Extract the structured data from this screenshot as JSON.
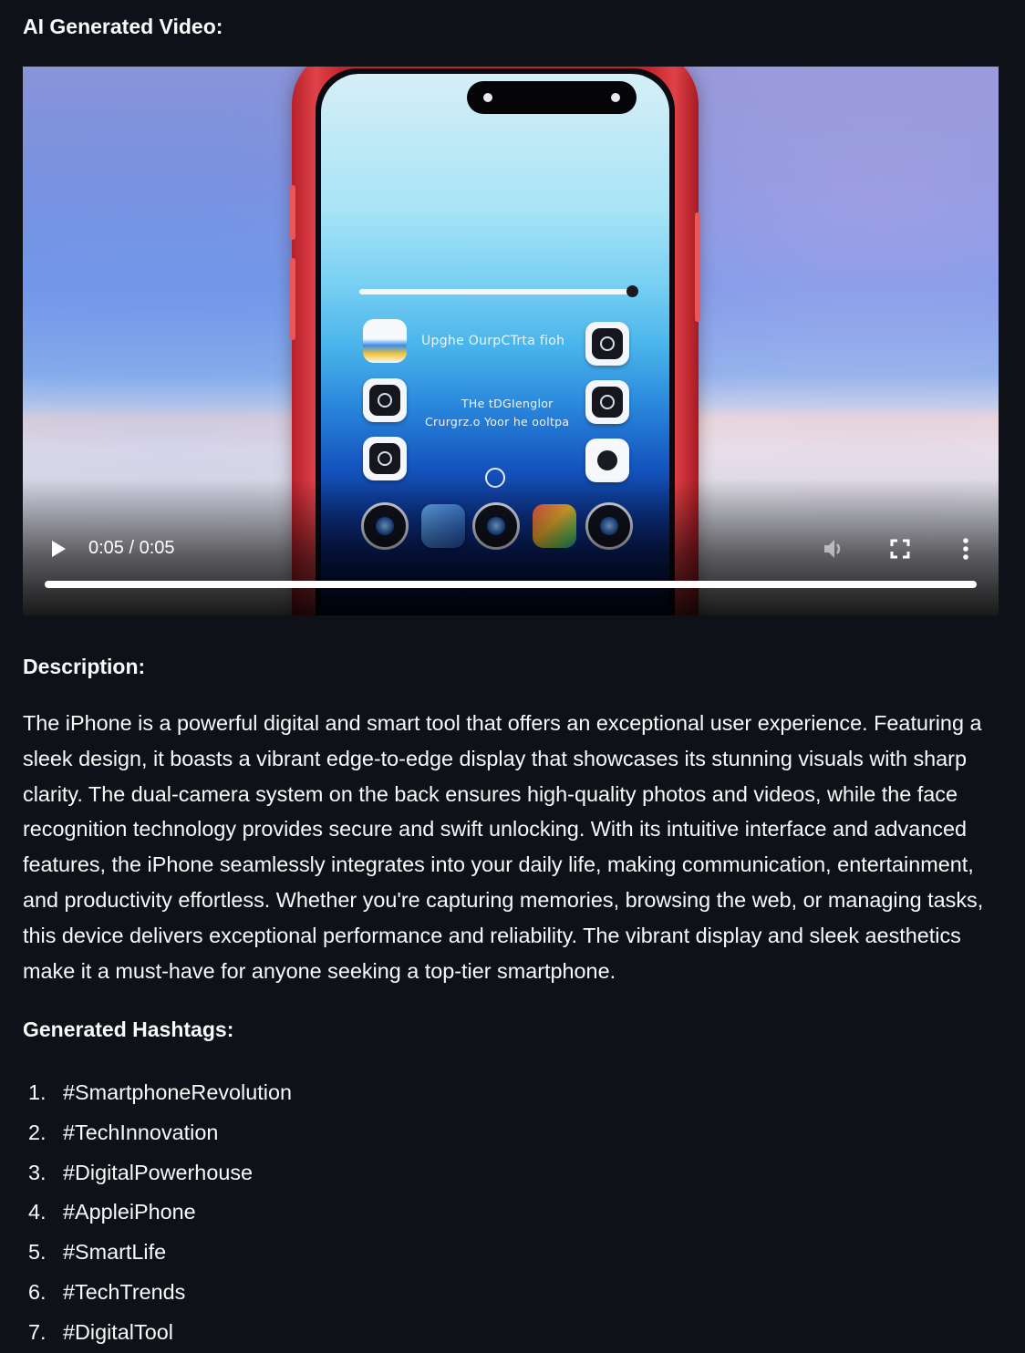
{
  "headings": {
    "video": "AI Generated Video:",
    "description": "Description:",
    "hashtags": "Generated Hashtags:"
  },
  "video": {
    "time_display": "0:05 / 0:05",
    "progress": 1.0,
    "screen_texts": {
      "line1": "Upghe OurpCTrta fioh",
      "line2": "THe tDGIenglor",
      "line3": "Crurgrz.o Yoor he ooltpa"
    },
    "controls": {
      "play_icon": "play-icon",
      "volume_icon": "volume-icon",
      "fullscreen_icon": "fullscreen-icon",
      "menu_icon": "more-vert-icon"
    }
  },
  "description": "The iPhone is a powerful digital and smart tool that offers an exceptional user experience. Featuring a sleek design, it boasts a vibrant edge-to-edge display that showcases its stunning visuals with sharp clarity. The dual-camera system on the back ensures high-quality photos and videos, while the face recognition technology provides secure and swift unlocking. With its intuitive interface and advanced features, the iPhone seamlessly integrates into your daily life, making communication, entertainment, and productivity effortless. Whether you're capturing memories, browsing the web, or managing tasks, this device delivers exceptional performance and reliability. The vibrant display and sleek aesthetics make it a must-have for anyone seeking a top-tier smartphone.",
  "hashtags": [
    {
      "num": "1.",
      "tag": "#SmartphoneRevolution"
    },
    {
      "num": "2.",
      "tag": "#TechInnovation"
    },
    {
      "num": "3.",
      "tag": "#DigitalPowerhouse"
    },
    {
      "num": "4.",
      "tag": "#AppleiPhone"
    },
    {
      "num": "5.",
      "tag": "#SmartLife"
    },
    {
      "num": "6.",
      "tag": "#TechTrends"
    },
    {
      "num": "7.",
      "tag": "#DigitalTool"
    }
  ],
  "colors": {
    "background": "#0e1117",
    "text": "#fafafa",
    "phone_red": "#c5242c"
  }
}
